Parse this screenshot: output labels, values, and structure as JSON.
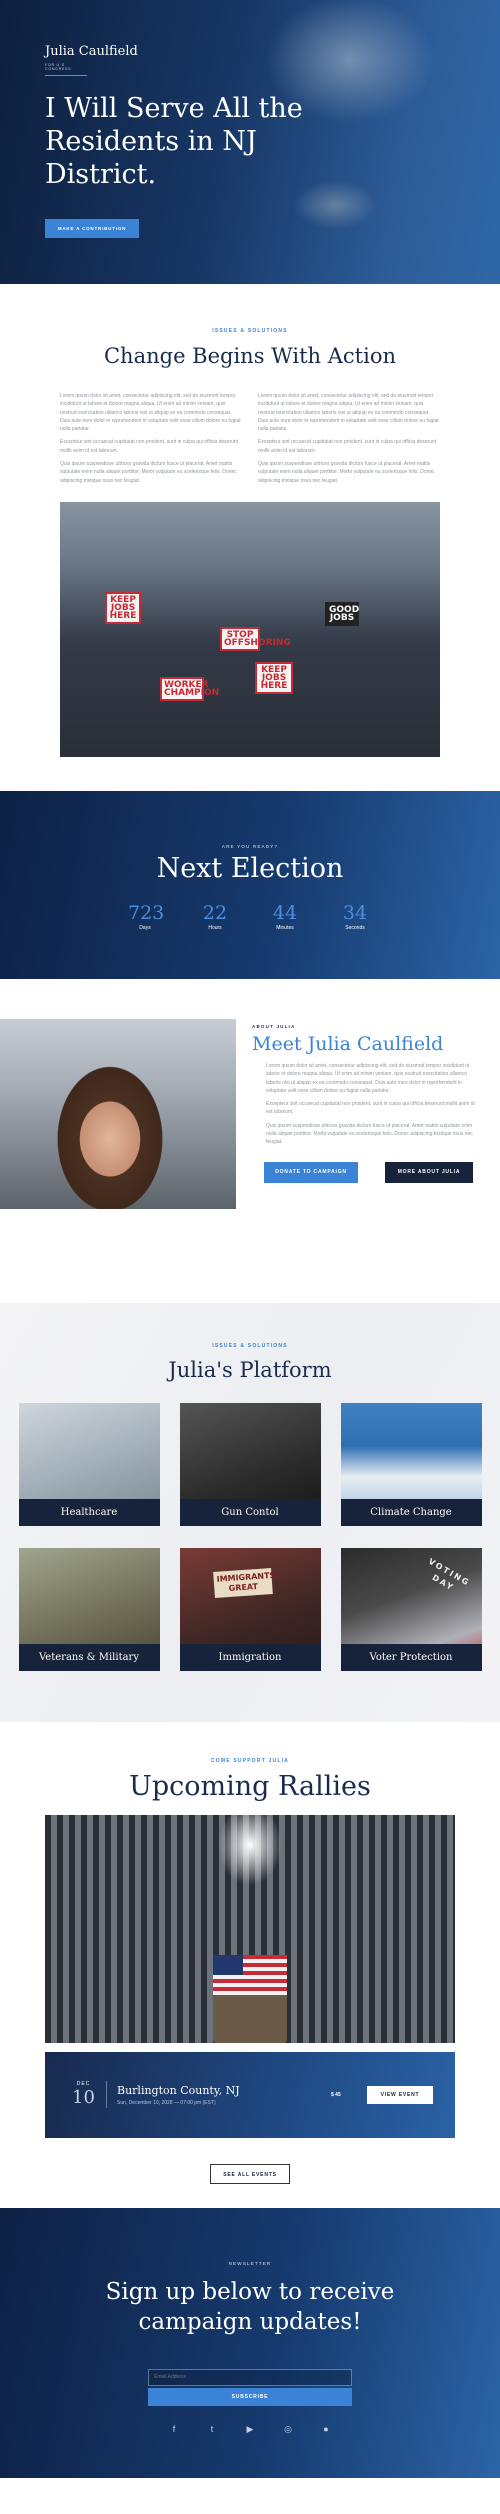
{
  "hero": {
    "logo_name": "Julia Caulfield",
    "logo_sub": "FOR U.S. CONGRESS",
    "headline": "I Will Serve All the Residents in NJ District.",
    "cta": "MAKE A CONTRIBUTION"
  },
  "issues": {
    "kicker": "ISSUES & SOLUTIONS",
    "title": "Change Begins With Action",
    "left": [
      "Lorem ipsum dolor sit amet, consectetur adipiscing elit, sed do eiusmod tempor incididunt ut labore et dolore magna aliqua. Ut enim ad minim veniam, quis nostrud exercitation ullamco laboris nisi ut aliquip ex ea commodo consequat. Duis aute irure dolor in reprehenderit in voluptate velit esse cillum dolore eu fugiat nulla pariatur.",
      "Excepteur sint occaecat cupidatat non proident, sunt in culpa qui officia deserunt mollit anim id est laborum.",
      "Quis ipsum suspendisse ultrices gravida dictum fusce ut placerat. Amet mattis vulputate enim nulla aliquet porttitor. Morbi vulputate eu scelerisque felis. Donec adipiscing tristique risus nec feugiat."
    ],
    "right": [
      "Lorem ipsum dolor sit amet, consectetur adipiscing elit, sed do eiusmod tempor incididunt ut labore et dolore magna aliqua. Ut enim ad minim veniam, quis nostrud exercitation ullamco laboris nisi ut aliquip ex ea commodo consequat. Duis aute irure dolor in reprehenderit in voluptate velit esse cillum dolore eu fugiat nulla pariatur.",
      "Excepteur sint occaecat cupidatat non proident, sunt in culpa qui officia deserunt mollit anim id est laborum.",
      "Quis ipsum suspendisse ultrices gravida dictum fusce ut placerat. Amet mattis vulputate enim nulla aliquet porttitor. Morbi vulputate eu scelerisque felis. Donec adipiscing tristique risus nec feugiat."
    ],
    "signs": [
      "KEEP JOBS HERE",
      "STOP OFFSHORING",
      "KEEP JOBS HERE",
      "WORKER CHAMPION",
      "GOOD JOBS"
    ]
  },
  "election": {
    "kicker": "ARE YOU READY?",
    "title": "Next Election",
    "countdown": [
      {
        "value": "723",
        "label": "Days"
      },
      {
        "value": "22",
        "label": "Hours"
      },
      {
        "value": "44",
        "label": "Minutes"
      },
      {
        "value": "34",
        "label": "Seconds"
      }
    ]
  },
  "about": {
    "kicker": "ABOUT JULIA",
    "title": "Meet Julia Caulfield",
    "paragraphs": [
      "Lorem ipsum dolor sit amet, consectetur adipiscing elit, sed do eiusmod tempor incididunt ut labore et dolore magna aliqua. Ut enim ad minim veniam, quis nostrud exercitation ullamco laboris nisi ut aliquip ex ea commodo consequat. Duis aute irure dolor in reprehenderit in voluptate velit esse cillum dolore eu fugiat nulla pariatur.",
      "Excepteur sint occaecat cupidatat non proident, sunt in culpa qui officia deserunt mollit anim id est laborum.",
      "Quis ipsum suspendisse ultrices gravida dictum fusce ut placerat. Amet mattis vulputate enim nulla aliquet porttitor. Morbi vulputate eu scelerisque felis. Donec adipiscing tristique risus nec feugiat."
    ],
    "btn_donate": "DONATE TO CAMPAIGN",
    "btn_more": "MORE ABOUT JULIA"
  },
  "platform": {
    "kicker": "ISSUES & SOLUTIONS",
    "title": "Julia's Platform",
    "cards": [
      {
        "label": "Healthcare"
      },
      {
        "label": "Gun Contol"
      },
      {
        "label": "Climate Change"
      },
      {
        "label": "Veterans & Military"
      },
      {
        "label": "Immigration"
      },
      {
        "label": "Voter Protection"
      }
    ],
    "sign_text": "IMMIGRANTS GREAT",
    "voting_text": "VOTING DAY"
  },
  "rallies": {
    "kicker": "COME SUPPORT JULIA",
    "title": "Upcoming Rallies",
    "event": {
      "month": "DEC",
      "day": "10",
      "title": "Burlington County, NJ",
      "when": "Sun, December 10, 2028 — 07:00 pm (EST)",
      "price": "$ 45",
      "btn": "VIEW EVENT"
    },
    "all_btn": "SEE ALL EVENTS"
  },
  "newsletter": {
    "kicker": "NEWSLETTER",
    "title": "Sign up below to receive campaign updates!",
    "placeholder": "Email Address",
    "submit": "SUBSCRIBE",
    "social": [
      "f",
      "t",
      "▶",
      "◎",
      "●"
    ]
  },
  "colors": {
    "accent": "#3b83d6",
    "navy": "#17233a",
    "heading": "#1a2c4d"
  }
}
